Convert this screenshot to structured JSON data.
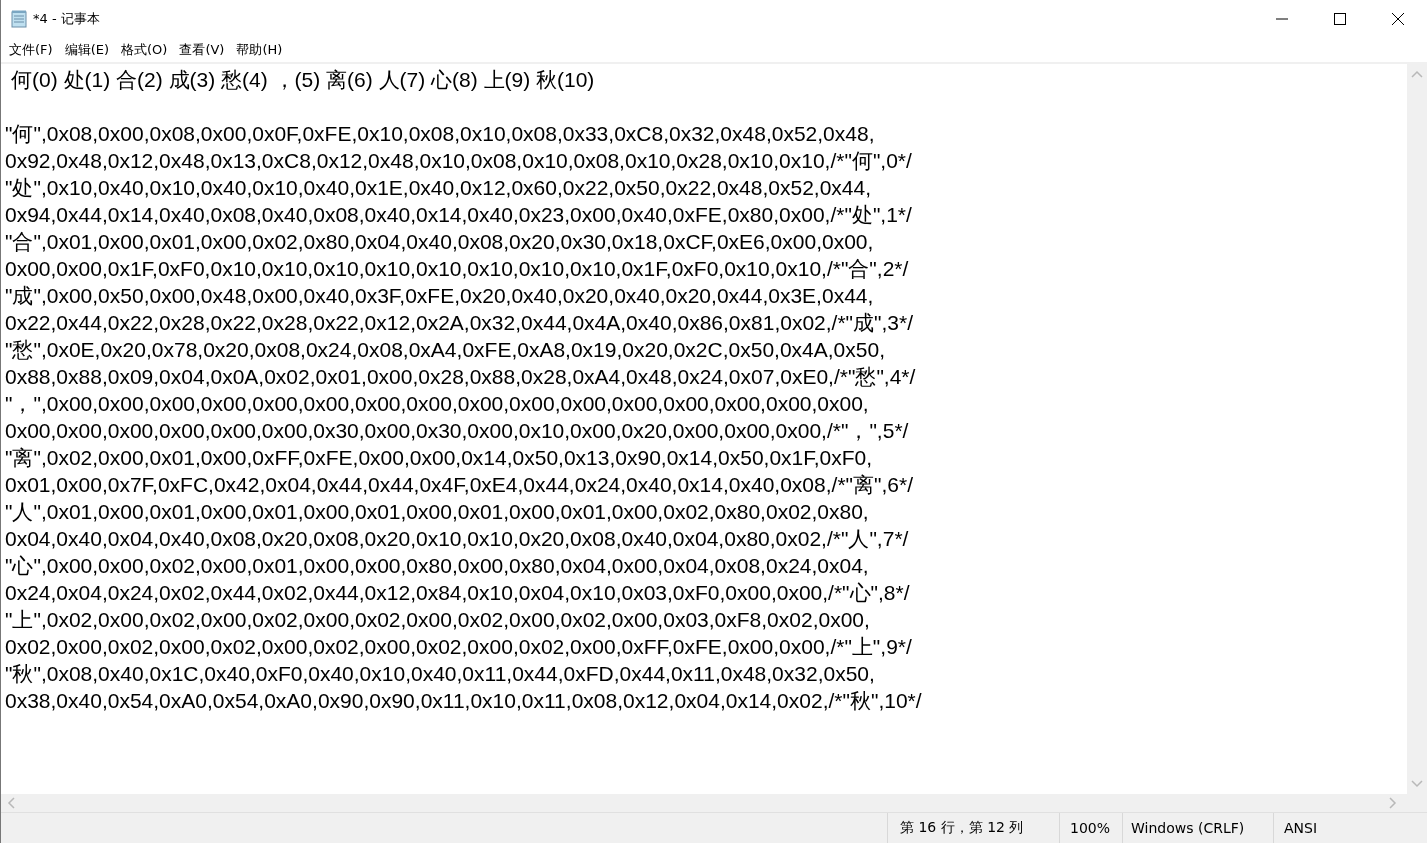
{
  "window": {
    "title": "*4 - 记事本"
  },
  "menu": [
    "文件(F)",
    "编辑(E)",
    "格式(O)",
    "查看(V)",
    "帮助(H)"
  ],
  "editor": {
    "first_line": "何(0) 处(1) 合(2) 成(3) 愁(4) ，(5) 离(6) 人(7) 心(8) 上(9) 秋(10)",
    "lines": [
      "\"何\",0x08,0x00,0x08,0x00,0x0F,0xFE,0x10,0x08,0x10,0x08,0x33,0xC8,0x32,0x48,0x52,0x48,",
      "0x92,0x48,0x12,0x48,0x13,0xC8,0x12,0x48,0x10,0x08,0x10,0x08,0x10,0x28,0x10,0x10,/*\"何\",0*/",
      "\"处\",0x10,0x40,0x10,0x40,0x10,0x40,0x1E,0x40,0x12,0x60,0x22,0x50,0x22,0x48,0x52,0x44,",
      "0x94,0x44,0x14,0x40,0x08,0x40,0x08,0x40,0x14,0x40,0x23,0x00,0x40,0xFE,0x80,0x00,/*\"处\",1*/",
      "\"合\",0x01,0x00,0x01,0x00,0x02,0x80,0x04,0x40,0x08,0x20,0x30,0x18,0xCF,0xE6,0x00,0x00,",
      "0x00,0x00,0x1F,0xF0,0x10,0x10,0x10,0x10,0x10,0x10,0x10,0x10,0x1F,0xF0,0x10,0x10,/*\"合\",2*/",
      "\"成\",0x00,0x50,0x00,0x48,0x00,0x40,0x3F,0xFE,0x20,0x40,0x20,0x40,0x20,0x44,0x3E,0x44,",
      "0x22,0x44,0x22,0x28,0x22,0x28,0x22,0x12,0x2A,0x32,0x44,0x4A,0x40,0x86,0x81,0x02,/*\"成\",3*/",
      "\"愁\",0x0E,0x20,0x78,0x20,0x08,0x24,0x08,0xA4,0xFE,0xA8,0x19,0x20,0x2C,0x50,0x4A,0x50,",
      "0x88,0x88,0x09,0x04,0x0A,0x02,0x01,0x00,0x28,0x88,0x28,0xA4,0x48,0x24,0x07,0xE0,/*\"愁\",4*/",
      "\"，\",0x00,0x00,0x00,0x00,0x00,0x00,0x00,0x00,0x00,0x00,0x00,0x00,0x00,0x00,0x00,0x00,",
      "0x00,0x00,0x00,0x00,0x00,0x00,0x30,0x00,0x30,0x00,0x10,0x00,0x20,0x00,0x00,0x00,/*\"，\",5*/",
      "\"离\",0x02,0x00,0x01,0x00,0xFF,0xFE,0x00,0x00,0x14,0x50,0x13,0x90,0x14,0x50,0x1F,0xF0,",
      "0x01,0x00,0x7F,0xFC,0x42,0x04,0x44,0x44,0x4F,0xE4,0x44,0x24,0x40,0x14,0x40,0x08,/*\"离\",6*/",
      "\"人\",0x01,0x00,0x01,0x00,0x01,0x00,0x01,0x00,0x01,0x00,0x01,0x00,0x02,0x80,0x02,0x80,",
      "0x04,0x40,0x04,0x40,0x08,0x20,0x08,0x20,0x10,0x10,0x20,0x08,0x40,0x04,0x80,0x02,/*\"人\",7*/",
      "\"心\",0x00,0x00,0x02,0x00,0x01,0x00,0x00,0x80,0x00,0x80,0x04,0x00,0x04,0x08,0x24,0x04,",
      "0x24,0x04,0x24,0x02,0x44,0x02,0x44,0x12,0x84,0x10,0x04,0x10,0x03,0xF0,0x00,0x00,/*\"心\",8*/",
      "\"上\",0x02,0x00,0x02,0x00,0x02,0x00,0x02,0x00,0x02,0x00,0x02,0x00,0x03,0xF8,0x02,0x00,",
      "0x02,0x00,0x02,0x00,0x02,0x00,0x02,0x00,0x02,0x00,0x02,0x00,0xFF,0xFE,0x00,0x00,/*\"上\",9*/",
      "\"秋\",0x08,0x40,0x1C,0x40,0xF0,0x40,0x10,0x40,0x11,0x44,0xFD,0x44,0x11,0x48,0x32,0x50,",
      "0x38,0x40,0x54,0xA0,0x54,0xA0,0x90,0x90,0x11,0x10,0x11,0x08,0x12,0x04,0x14,0x02,/*\"秋\",10*/"
    ]
  },
  "status_bar": {
    "position": "第 16 行，第 12 列",
    "zoom": "100%",
    "line_ending": "Windows (CRLF)",
    "encoding": "ANSI"
  }
}
